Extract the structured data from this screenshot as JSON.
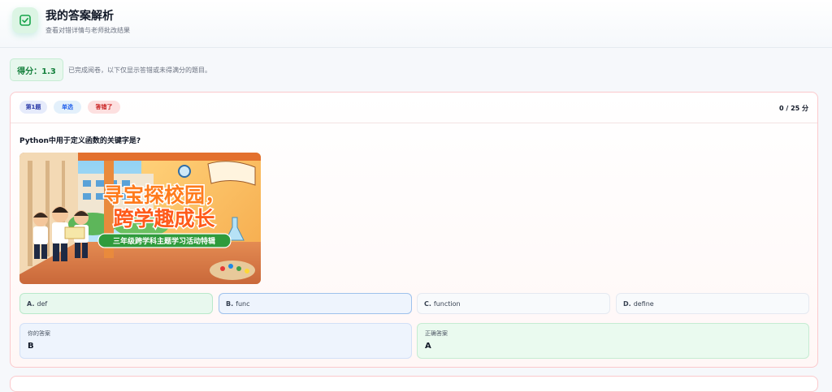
{
  "header": {
    "title": "我的答案解析",
    "subtitle": "查看对错详情与老师批改结果",
    "icon": "checkbox-icon"
  },
  "summary": {
    "score_label": "得分：1.3",
    "note": "已完成阅卷，以下仅显示答错或未得满分的题目。"
  },
  "question": {
    "number_tag": "第1题",
    "type_tag": "单选",
    "status_tag": "答错了",
    "points": "0 / 25 分",
    "text": "Python中用于定义函数的关键字是?",
    "image": {
      "title_line1": "寻宝探校园，",
      "title_line2": "跨学趣成长",
      "banner": "三年级跨学科主题学习活动特辑"
    },
    "options": [
      {
        "key": "A.",
        "text": "def"
      },
      {
        "key": "B.",
        "text": "func"
      },
      {
        "key": "C.",
        "text": "function"
      },
      {
        "key": "D.",
        "text": "define"
      }
    ],
    "your_answer_label": "你的答案",
    "your_answer": "B",
    "correct_answer_label": "正确答案",
    "correct_answer": "A"
  },
  "colors": {
    "correct": "#15803d",
    "wrong": "#c81e1e",
    "selected_border": "#9ec1ec",
    "accent_blue": "#2563eb"
  }
}
